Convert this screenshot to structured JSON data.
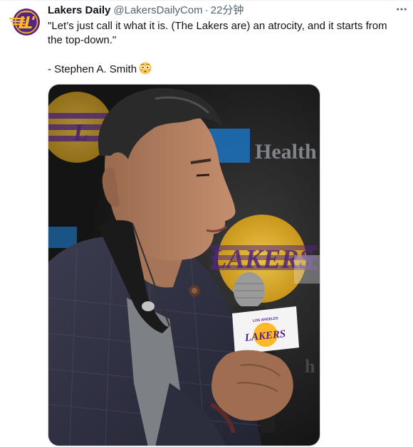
{
  "tweet": {
    "display_name": "Lakers Daily",
    "handle": "@LakersDailyCom",
    "separator": "·",
    "time": "22分钟",
    "text_line1": "\"Let’s just call it what it is. (The Lakers are) an atrocity, and it starts from the top-down.\"",
    "text_line2": "- Stephen A. Smith",
    "emoji": "flushed-face-emoji"
  },
  "icons": {
    "more": "more-horizontal-icon",
    "avatar": "lakers-daily-logo"
  },
  "media": {
    "background_logo_text": "LAKERS",
    "sponsor_text": "Health",
    "mic_flag_top": "LOS ANGELES",
    "mic_flag_text": "LAKERS"
  },
  "colors": {
    "text": "#0f1419",
    "secondary": "#536471",
    "lakers_purple": "#552583",
    "lakers_gold": "#FDB927"
  }
}
